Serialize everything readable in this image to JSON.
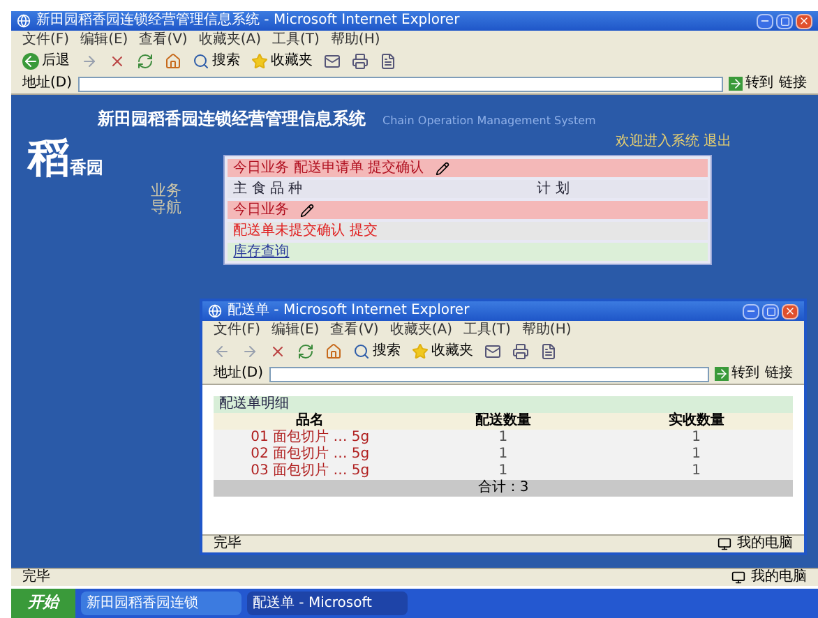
{
  "main_window": {
    "title": "新田园稻香园连锁经营管理信息系统 - Microsoft Internet Explorer",
    "menu": [
      "文件(F)",
      "编辑(E)",
      "查看(V)",
      "收藏夹(A)",
      "工具(T)",
      "帮助(H)"
    ],
    "toolbar": {
      "back": "后退",
      "search": "搜索",
      "favorites": "收藏夹"
    },
    "address": {
      "label": "地址(D)",
      "go": "转到",
      "links": "链接"
    },
    "page": {
      "logo": "稻",
      "logo_small": "香园",
      "title": "新田园稻香园连锁经营管理信息系统",
      "subtitle": "Chain Operation Management System",
      "notice": "欢迎进入系统 退出",
      "side_label": "业务导航",
      "panel_rows": [
        {
          "kind": "header",
          "text": "今日业务 配送申请单 提交确认"
        },
        {
          "kind": "items",
          "text": "主 食 品 种",
          "extra": "计 划"
        },
        {
          "kind": "header",
          "text": "今日业务"
        },
        {
          "kind": "alert",
          "text": "配送单未提交确认 提交"
        },
        {
          "kind": "link",
          "text": "库存查询"
        }
      ]
    },
    "status": {
      "text": "完毕",
      "zone": "我的电脑"
    }
  },
  "popup_window": {
    "title": "配送单 - Microsoft Internet Explorer",
    "menu": [
      "文件(F)",
      "编辑(E)",
      "查看(V)",
      "收藏夹(A)",
      "工具(T)",
      "帮助(H)"
    ],
    "toolbar": {
      "search": "搜索",
      "favorites": "收藏夹"
    },
    "address": {
      "label": "地址(D)",
      "go": "转到",
      "links": "链接"
    },
    "section_title": "配送单明细",
    "columns": [
      "品名",
      "配送数量",
      "实收数量"
    ],
    "rows": [
      {
        "cells": [
          "01 面包切片 … 5g",
          "1",
          "1"
        ]
      },
      {
        "cells": [
          "02 面包切片 … 5g",
          "1",
          "1"
        ]
      },
      {
        "cells": [
          "03 面包切片 … 5g",
          "1",
          "1"
        ]
      }
    ],
    "footer": "合计：3",
    "status": {
      "text": "完毕",
      "zone": "我的电脑"
    }
  },
  "taskbar": {
    "start": "开始",
    "tasks": [
      {
        "label": "新田园稻香园连锁",
        "selected": false
      },
      {
        "label": "配送单 - Microsoft",
        "selected": true
      }
    ]
  }
}
